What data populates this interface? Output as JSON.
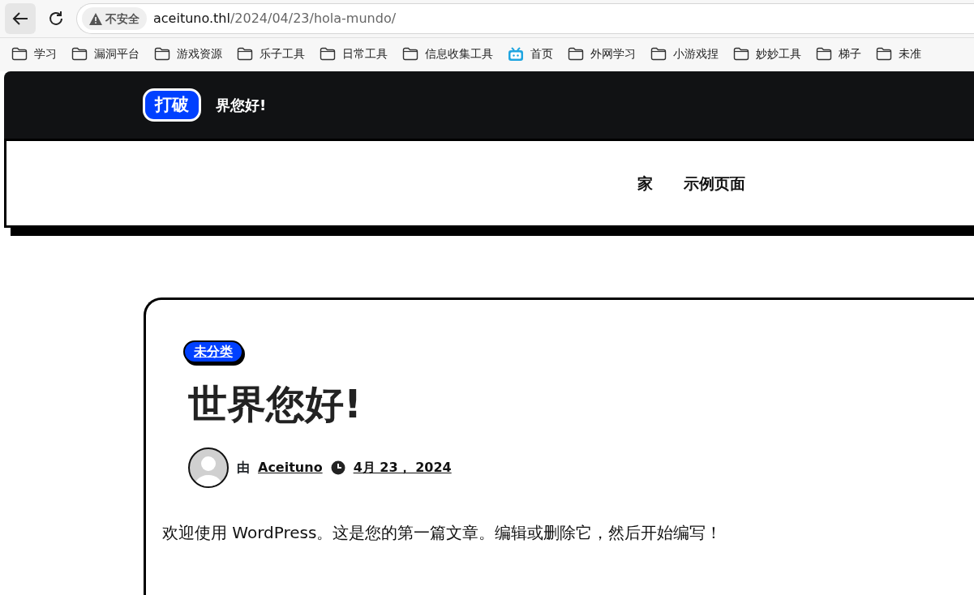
{
  "browser": {
    "security_label": "不安全",
    "url_host": "aceituno.thl",
    "url_path": "/2024/04/23/hola-mundo/"
  },
  "bookmarks": [
    {
      "label": "学习",
      "kind": "folder"
    },
    {
      "label": "漏洞平台",
      "kind": "folder"
    },
    {
      "label": "游戏资源",
      "kind": "folder"
    },
    {
      "label": "乐子工具",
      "kind": "folder"
    },
    {
      "label": "日常工具",
      "kind": "folder"
    },
    {
      "label": "信息收集工具",
      "kind": "folder"
    },
    {
      "label": "首页",
      "kind": "site"
    },
    {
      "label": "外网学习",
      "kind": "folder"
    },
    {
      "label": "小游戏捏",
      "kind": "folder"
    },
    {
      "label": "妙妙工具",
      "kind": "folder"
    },
    {
      "label": "梯子",
      "kind": "folder"
    },
    {
      "label": "未准",
      "kind": "folder"
    }
  ],
  "site": {
    "ticker": {
      "badge": "打破",
      "text": "界您好!"
    },
    "nav": [
      {
        "label": "家"
      },
      {
        "label": "示例页面"
      }
    ],
    "post": {
      "category": "未分类",
      "title": "世界您好!",
      "byline_prefix": "由",
      "author": "Aceituno",
      "date": "4月 23， 2024",
      "body": "欢迎使用 WordPress。这是您的第一篇文章。编辑或删除它，然后开始编写！"
    }
  }
}
